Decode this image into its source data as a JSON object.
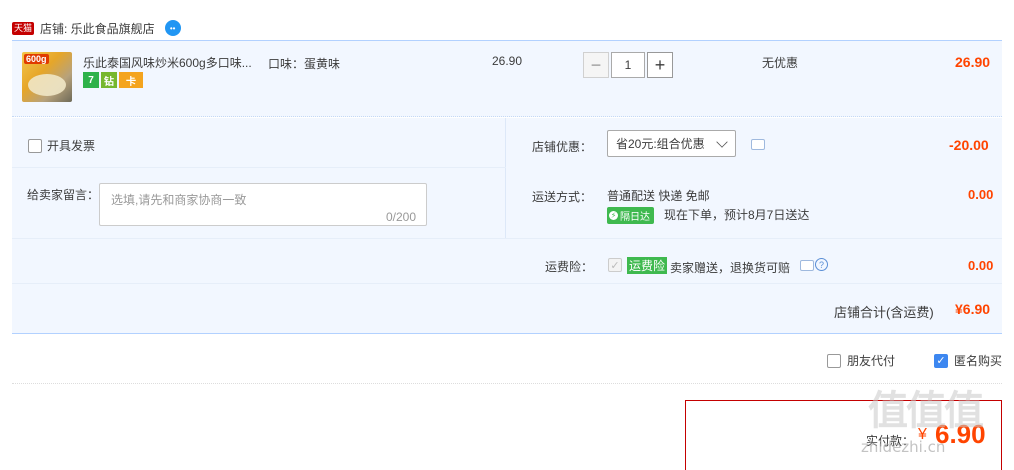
{
  "shop": {
    "badge": "天猫",
    "name": "店铺: 乐此食品旗舰店",
    "ww_icon": "wangwang-chat-icon"
  },
  "item": {
    "thumb_label": "600g",
    "title": "乐此泰国风味炒米600g多口味...",
    "flags": [
      "7",
      "钻",
      "卡"
    ],
    "sku": "口味：蛋黄味",
    "unit_price": "26.90",
    "quantity": "1",
    "qty_minus": "−",
    "qty_plus": "+",
    "discount": "无优惠",
    "subtotal": "26.90"
  },
  "invoice": {
    "label": "开具发票"
  },
  "message": {
    "label": "给卖家留言：",
    "placeholder": "选填,请先和商家协商一致",
    "counter": "0/200"
  },
  "shop_discount": {
    "label": "店铺优惠：",
    "selected": "省20元:组合优惠",
    "amount": "-20.00"
  },
  "shipping": {
    "label": "运送方式：",
    "method": "普通配送 快递 免邮",
    "badge": "隔日达",
    "eta": "现在下单，预计8月7日送达",
    "amount": "0.00"
  },
  "insurance": {
    "label": "运费险：",
    "badge": "运费险",
    "text": "卖家赠送，退换货可赔",
    "help": "?",
    "amount": "0.00"
  },
  "shop_total": {
    "label": "店铺合计(含运费)",
    "amount": "¥6.90"
  },
  "options": {
    "friend_pay": "朋友代付",
    "anonymous": "匿名购买",
    "anonymous_checked": true
  },
  "payment": {
    "label": "实付款：",
    "currency": "¥",
    "amount": "6.90"
  },
  "watermark": {
    "logo": "值值值",
    "site": "zhidezhi.cn"
  },
  "colors": {
    "price": "#ff4400",
    "panel_bg": "#f2f7ff",
    "border_blue": "#b2d1ff",
    "badge_green": "#3fb94f",
    "check_blue": "#3d87f0"
  }
}
